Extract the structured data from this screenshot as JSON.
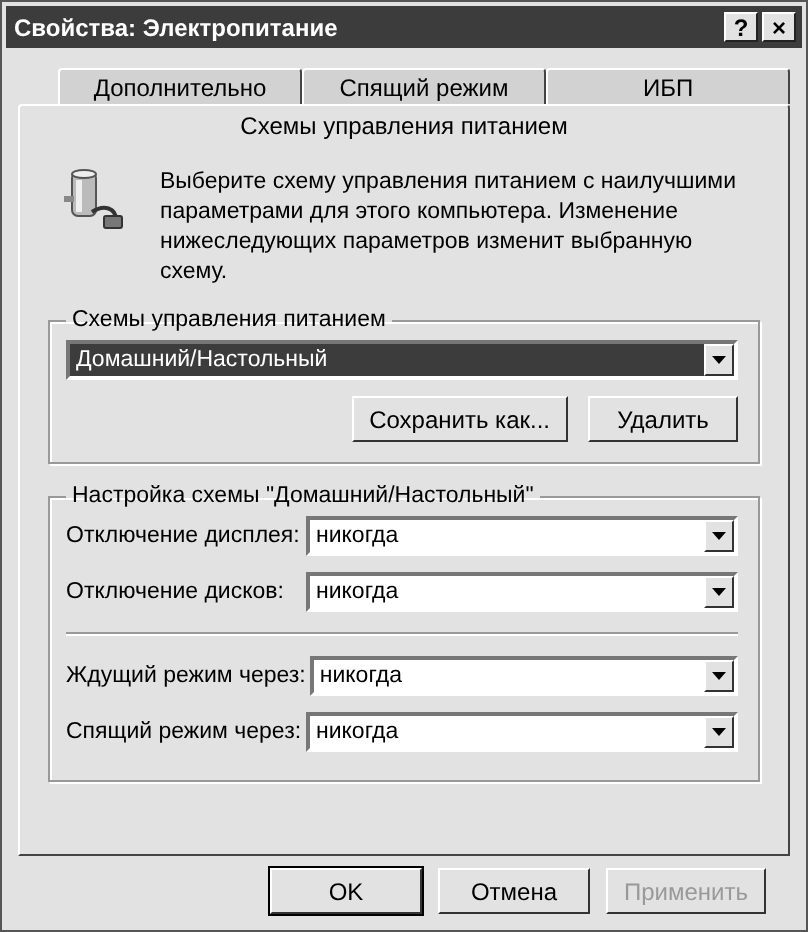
{
  "window": {
    "title": "Свойства: Электропитание",
    "help_button": "?",
    "close_button": "×"
  },
  "tab_rows": [
    [
      {
        "label": "Дополнительно",
        "selected": false
      },
      {
        "label": "Спящий режим",
        "selected": false
      },
      {
        "label": "ИБП",
        "selected": false
      }
    ],
    [
      {
        "label": "Схемы управления питанием",
        "selected": true
      }
    ]
  ],
  "intro": "Выберите схему управления питанием с наилучшими параметрами для этого компьютера. Изменение нижеследующих параметров изменит выбранную схему.",
  "schemes_group": {
    "title": "Схемы управления питанием",
    "value": "Домашний/Настольный",
    "focused": true,
    "buttons": [
      {
        "label": "Сохранить как...",
        "disabled": false
      },
      {
        "label": "Удалить",
        "disabled": false
      }
    ]
  },
  "settings_group": {
    "title": "Настройка схемы \"Домашний/Настольный\"",
    "sections": [
      [
        {
          "label": "Отключение дисплея:",
          "value": "никогда"
        },
        {
          "label": "Отключение дисков:",
          "value": "никогда"
        }
      ],
      [
        {
          "label": "Ждущий режим через:",
          "value": "никогда"
        },
        {
          "label": "Спящий режим через:",
          "value": "никогда"
        }
      ]
    ]
  },
  "buttons": [
    {
      "label": "OK",
      "default": true,
      "disabled": false
    },
    {
      "label": "Отмена",
      "default": false,
      "disabled": false
    },
    {
      "label": "Применить",
      "default": false,
      "disabled": true
    }
  ]
}
